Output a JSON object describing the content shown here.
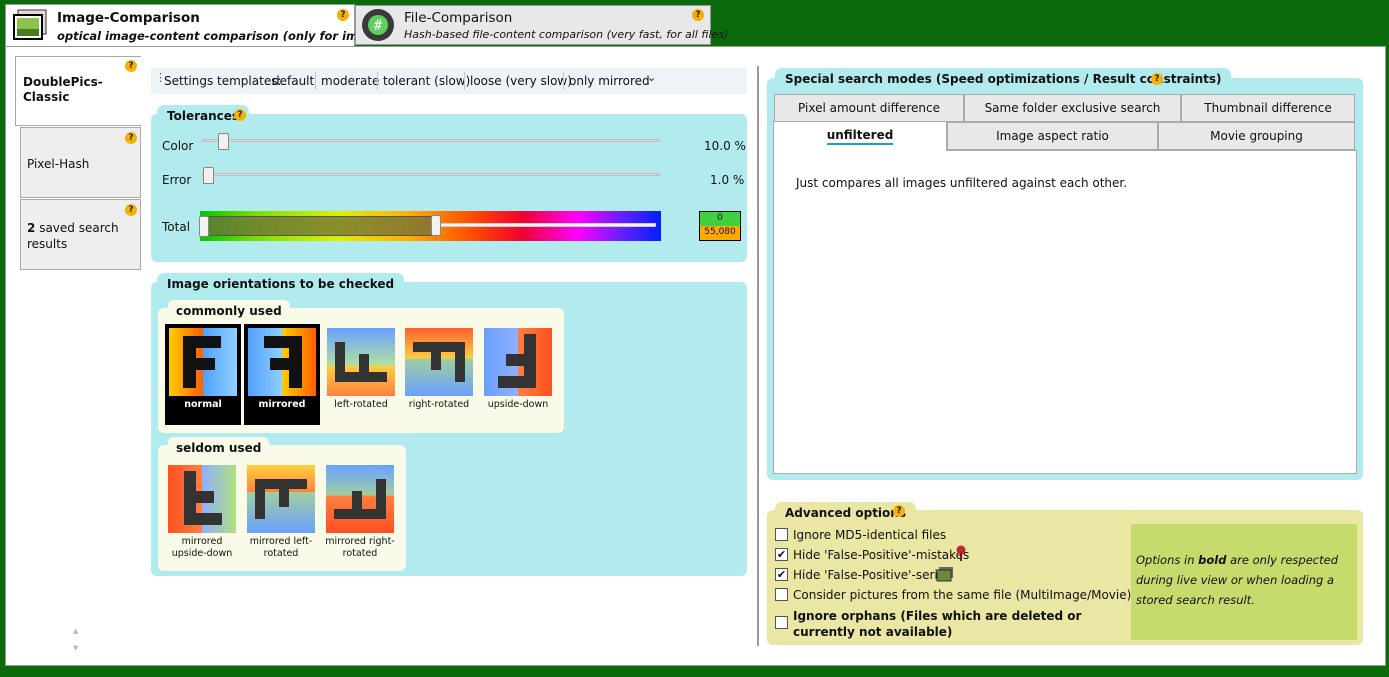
{
  "top_tabs": [
    {
      "title": "Image-Comparison",
      "subtitle": "optical image-content comparison (only for images)"
    },
    {
      "title": "File-Comparison",
      "subtitle": "Hash-based file-content comparison (very fast, for all files)"
    }
  ],
  "help_glyph": "?",
  "side_tabs": {
    "classic": "DoublePics-Classic",
    "pixelhash": "Pixel-Hash",
    "saved_count": "2",
    "saved_label": "saved search results"
  },
  "templates": {
    "label": "Settings templates:",
    "items": [
      "default",
      "moderate",
      "tolerant (slow)",
      "loose (very slow)",
      "only mirrored"
    ],
    "more": "⌄"
  },
  "tolerances": {
    "title": "Tolerances",
    "color_label": "Color",
    "color_value": "10.0 %",
    "color_fraction": 0.1,
    "error_label": "Error",
    "error_value": "1.0 %",
    "error_fraction": 0.01,
    "total_label": "Total",
    "total_top": "0",
    "total_bottom": "55,080"
  },
  "orientations": {
    "title": "Image orientations to be checked",
    "common_title": "commonly used",
    "common": [
      {
        "label": "normal",
        "selected": true
      },
      {
        "label": "mirrored",
        "selected": true
      },
      {
        "label": "left-rotated",
        "selected": false
      },
      {
        "label": "right-rotated",
        "selected": false
      },
      {
        "label": "upside-down",
        "selected": false
      }
    ],
    "seldom_title": "seldom used",
    "seldom": [
      {
        "label": "mirrored upside-down",
        "selected": false
      },
      {
        "label": "mirrored left-rotated",
        "selected": false
      },
      {
        "label": "mirrored right-rotated",
        "selected": false
      }
    ]
  },
  "special": {
    "title": "Special search modes (Speed optimizations / Result constraints)",
    "tabs_row1": [
      "Pixel amount difference",
      "Same folder exclusive search",
      "Thumbnail difference"
    ],
    "tabs_row2": [
      "unfiltered",
      "Image aspect ratio",
      "Movie grouping"
    ],
    "selected_tab": "unfiltered",
    "description": "Just compares all images unfiltered against each other."
  },
  "advanced": {
    "title": "Advanced options",
    "options": [
      {
        "label": "Ignore MD5-identical files",
        "checked": false,
        "bold": false
      },
      {
        "label": "Hide 'False-Positive'-mistakes",
        "checked": true,
        "bold": false
      },
      {
        "label": "Hide 'False-Positive'-series",
        "checked": true,
        "bold": false
      },
      {
        "label": "Consider pictures from the same file (MultiImage/Movie)",
        "checked": false,
        "bold": false
      },
      {
        "label": "Ignore orphans (Files which are deleted or currently not available)",
        "checked": false,
        "bold": true
      }
    ],
    "note_pre": "Options in ",
    "note_bold": "bold",
    "note_post": " are only respected during live view or when loading a stored search result."
  },
  "scroll": {
    "up": "▲",
    "down": "▼"
  }
}
